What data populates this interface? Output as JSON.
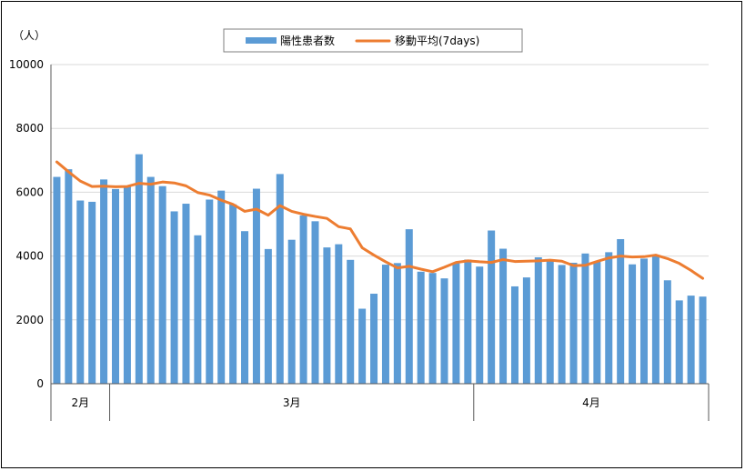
{
  "chart_data": {
    "type": "bar",
    "ylabel": "（人）",
    "ylim": [
      0,
      10000
    ],
    "yticks": [
      "0",
      "2000",
      "4000",
      "6000",
      "8000",
      "10000"
    ],
    "grid": true,
    "legend_position": "top-center",
    "month_groups": [
      {
        "label": "2月",
        "count": 5
      },
      {
        "label": "3月",
        "count": 31
      },
      {
        "label": "4月",
        "count": 20
      }
    ],
    "series": [
      {
        "name": "陽性患者数",
        "type": "bar",
        "color": "#5b9bd5",
        "values": [
          6480,
          6720,
          5740,
          5700,
          6400,
          6100,
          6170,
          7190,
          6480,
          6190,
          5400,
          5640,
          4650,
          5770,
          6050,
          5620,
          4780,
          6110,
          4220,
          6570,
          4510,
          5270,
          5090,
          4270,
          4370,
          3880,
          2350,
          2820,
          3730,
          3780,
          4840,
          3510,
          3470,
          3300,
          3790,
          3890,
          3670,
          4800,
          4230,
          3050,
          3330,
          3960,
          3840,
          3720,
          3790,
          4080,
          3820,
          4120,
          4530,
          3740,
          3920,
          4010,
          3240,
          2610,
          2760,
          2730
        ]
      },
      {
        "name": "移動平均(7days)",
        "type": "line",
        "color": "#ed7d31",
        "values": [
          6950,
          6640,
          6350,
          6180,
          6190,
          6170,
          6180,
          6280,
          6250,
          6320,
          6290,
          6200,
          5990,
          5910,
          5750,
          5620,
          5400,
          5470,
          5280,
          5580,
          5400,
          5310,
          5240,
          5180,
          4920,
          4850,
          4260,
          4030,
          3820,
          3630,
          3680,
          3590,
          3510,
          3650,
          3800,
          3850,
          3820,
          3800,
          3890,
          3830,
          3840,
          3850,
          3870,
          3840,
          3700,
          3710,
          3830,
          3940,
          4000,
          3970,
          3980,
          4030,
          3920,
          3770,
          3550,
          3300
        ]
      }
    ]
  }
}
